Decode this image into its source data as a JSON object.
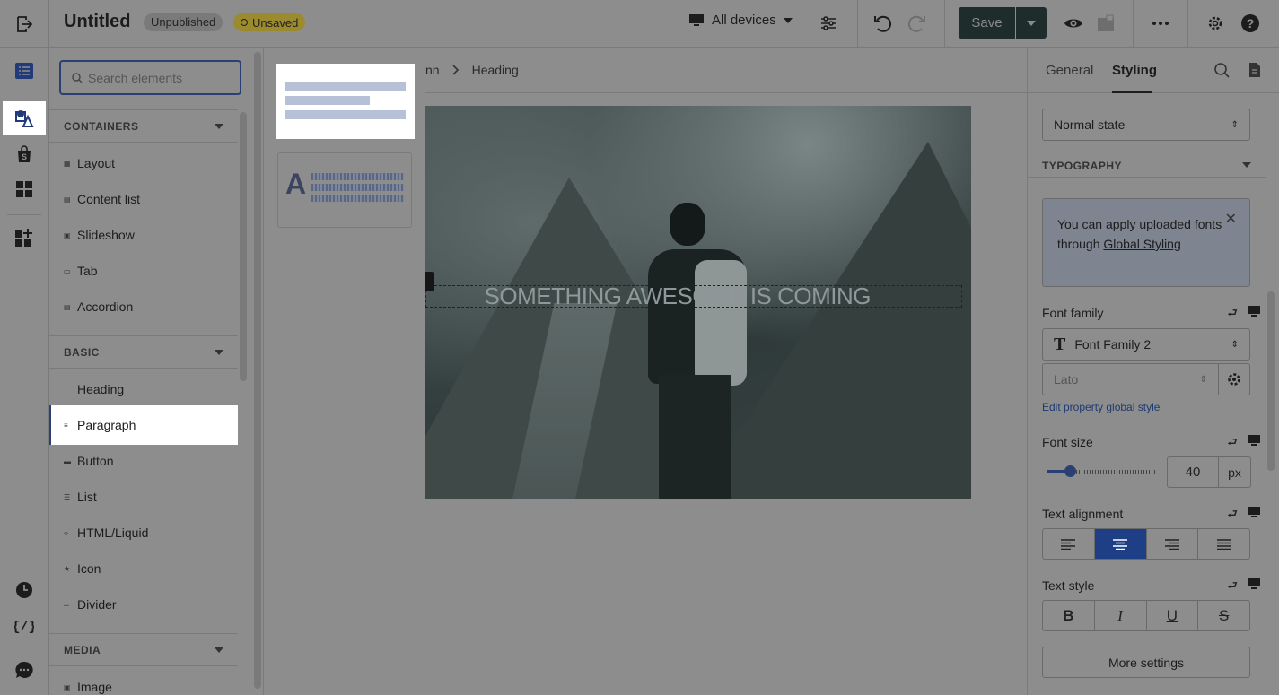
{
  "header": {
    "title": "Untitled",
    "badge_unpublished": "Unpublished",
    "badge_unsaved": "Unsaved",
    "devices_label": "All devices",
    "save_label": "Save"
  },
  "panel": {
    "search_placeholder": "Search elements",
    "sections": {
      "containers": "CONTAINERS",
      "basic": "BASIC",
      "media": "MEDIA"
    },
    "containers_items": [
      "Layout",
      "Content list",
      "Slideshow",
      "Tab",
      "Accordion"
    ],
    "basic_items": [
      "Heading",
      "Paragraph",
      "Button",
      "List",
      "HTML/Liquid",
      "Icon",
      "Divider"
    ],
    "media_items": [
      "Image"
    ],
    "active_item": "Paragraph"
  },
  "canvas": {
    "breadcrumb_prev": "nn",
    "breadcrumb_current": "Heading",
    "hero_heading": "SOMETHING AWESOME IS COMING"
  },
  "right_panel": {
    "tabs": [
      "General",
      "Styling"
    ],
    "active_tab": "Styling",
    "state_select": "Normal state",
    "section_typography": "TYPOGRAPHY",
    "notice_text_1": "You can apply uploaded fonts through ",
    "notice_link": "Global Styling",
    "font_family_label": "Font family",
    "font_family_value": "Font Family 2",
    "font_value": "Lato",
    "edit_global_link": "Edit property global style",
    "font_size_label": "Font size",
    "font_size_value": "40",
    "font_size_unit": "px",
    "text_alignment_label": "Text alignment",
    "text_style_label": "Text style",
    "text_style_buttons": [
      "B",
      "I",
      "U",
      "S"
    ],
    "more_settings": "More settings"
  }
}
